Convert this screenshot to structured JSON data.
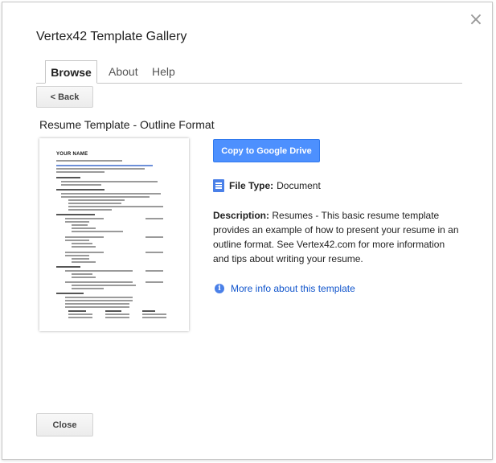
{
  "dialog": {
    "title": "Vertex42 Template Gallery",
    "close_glyph": "×"
  },
  "tabs": [
    {
      "label": "Browse",
      "active": true
    },
    {
      "label": "About",
      "active": false
    },
    {
      "label": "Help",
      "active": false
    }
  ],
  "back_button": "< Back",
  "template": {
    "title": "Resume Template - Outline Format",
    "thumbnail_name": "YOUR NAME",
    "copy_button": "Copy to Google Drive",
    "file_type_label": "File Type:",
    "file_type_value": "Document",
    "description_label": "Description:",
    "description_text": "Resumes - This basic resume template provides an example of how to present your resume in an outline format. See Vertex42.com for more information and tips about writing your resume.",
    "more_info": "More info about this template"
  },
  "close_button": "Close",
  "icons": {
    "file_type": "document-icon",
    "more_info": "info-icon",
    "close": "close-icon"
  },
  "colors": {
    "primary_button": "#4d90fe",
    "link": "#1155cc",
    "doc_icon": "#4a80e8"
  }
}
